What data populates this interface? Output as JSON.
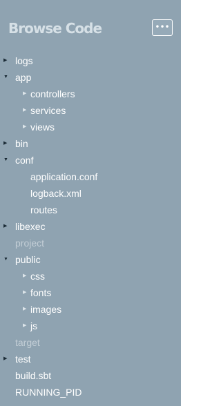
{
  "header": {
    "title": "Browse Code",
    "menu_label": "•••"
  },
  "tree": [
    {
      "label": "logs",
      "kind": "folder",
      "expanded": false
    },
    {
      "label": "app",
      "kind": "folder",
      "expanded": true
    },
    {
      "label": "controllers",
      "kind": "folder",
      "expanded": false
    },
    {
      "label": "services",
      "kind": "folder",
      "expanded": false
    },
    {
      "label": "views",
      "kind": "folder",
      "expanded": false
    },
    {
      "label": "bin",
      "kind": "folder",
      "expanded": false
    },
    {
      "label": "conf",
      "kind": "folder",
      "expanded": true
    },
    {
      "label": "application.conf",
      "kind": "file"
    },
    {
      "label": "logback.xml",
      "kind": "file"
    },
    {
      "label": "routes",
      "kind": "file"
    },
    {
      "label": "libexec",
      "kind": "folder",
      "expanded": false
    },
    {
      "label": "project",
      "kind": "folder",
      "dimmed": true
    },
    {
      "label": "public",
      "kind": "folder",
      "expanded": true
    },
    {
      "label": "css",
      "kind": "folder",
      "expanded": false
    },
    {
      "label": "fonts",
      "kind": "folder",
      "expanded": false
    },
    {
      "label": "images",
      "kind": "folder",
      "expanded": false
    },
    {
      "label": "js",
      "kind": "folder",
      "expanded": false
    },
    {
      "label": "target",
      "kind": "folder",
      "dimmed": true
    },
    {
      "label": "test",
      "kind": "folder",
      "expanded": false
    },
    {
      "label": "build.sbt",
      "kind": "file"
    },
    {
      "label": "RUNNING_PID",
      "kind": "file"
    }
  ],
  "icons": {
    "collapsed": "arrow-right-icon",
    "expanded": "arrow-down-icon"
  },
  "colors": {
    "panel_background": "#8fa3b1",
    "title": "#d6e0e6",
    "item_text": "#ffffff",
    "dimmed_text": "#c3ced6",
    "arrow": "#1a2a35"
  }
}
